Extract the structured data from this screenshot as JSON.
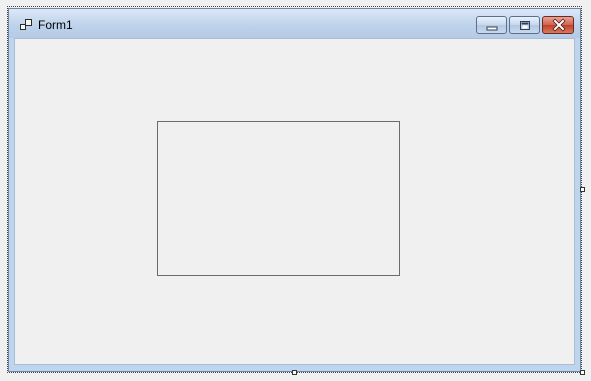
{
  "window": {
    "title": "Form1"
  },
  "icons": {
    "app": "form-icon",
    "minimize": "minimize-icon",
    "maximize": "maximize-icon",
    "close": "close-icon"
  },
  "colors": {
    "titlebar": "#bcd1ea",
    "client": "#f0f0f0",
    "close_button": "#c0402a"
  }
}
